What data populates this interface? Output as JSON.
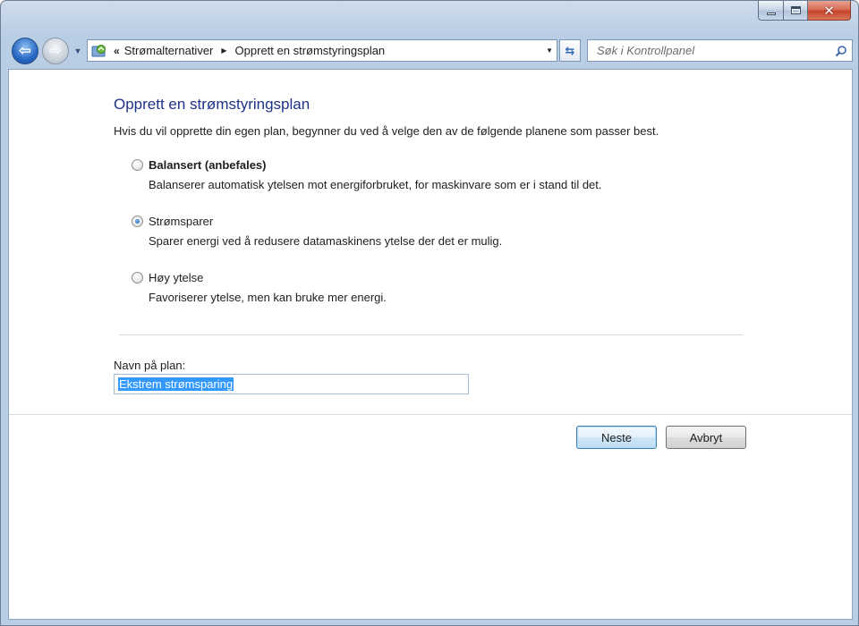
{
  "window": {
    "caption": {
      "minimize": "minimize-icon",
      "maximize": "maximize-icon",
      "close": "close-icon"
    }
  },
  "nav": {
    "back_icon": "back-arrow-icon",
    "forward_icon": "forward-arrow-icon",
    "address": {
      "prefix": "«",
      "crumbs": [
        "Strømalternativer",
        "Opprett en strømstyringsplan"
      ]
    },
    "search": {
      "placeholder": "Søk i Kontrollpanel"
    }
  },
  "main": {
    "title": "Opprett en strømstyringsplan",
    "intro": "Hvis du vil opprette din egen plan, begynner du ved å velge den av de følgende planene som passer best.",
    "options": [
      {
        "label": "Balansert (anbefales)",
        "description": "Balanserer automatisk ytelsen mot energiforbruket, for maskinvare som er i stand til det.",
        "checked": false
      },
      {
        "label": "Strømsparer",
        "description": "Sparer energi ved å redusere datamaskinens ytelse der det er mulig.",
        "checked": true
      },
      {
        "label": "Høy ytelse",
        "description": "Favoriserer ytelse, men kan bruke mer energi.",
        "checked": false
      }
    ],
    "plan_name": {
      "label": "Navn på plan:",
      "value": "Ekstrem strømsparing"
    }
  },
  "buttons": {
    "next": "Neste",
    "cancel": "Avbryt"
  },
  "colors": {
    "title": "#1e3287",
    "selection": "#3399ff",
    "accent": "#2767c2"
  }
}
